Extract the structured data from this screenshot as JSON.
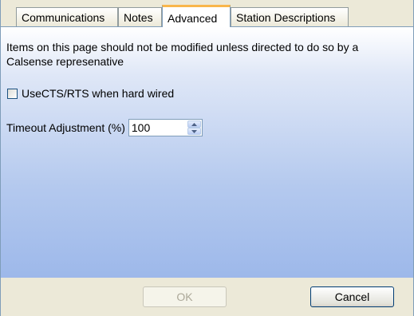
{
  "tabs": [
    {
      "label": "Communications",
      "active": false
    },
    {
      "label": "Notes",
      "active": false
    },
    {
      "label": "Advanced",
      "active": true
    },
    {
      "label": "Station Descriptions",
      "active": false
    }
  ],
  "advanced": {
    "description": "Items on this page should not be modified unless directed to do so by a Calsense represenative",
    "use_cts_rts": {
      "label": "UseCTS/RTS when hard wired",
      "checked": false
    },
    "timeout_adjustment": {
      "label": "Timeout Adjustment (%)",
      "value": "100"
    }
  },
  "buttons": {
    "ok": "OK",
    "ok_enabled": false,
    "cancel": "Cancel"
  },
  "colors": {
    "active_tab_accent": "#f9b64b",
    "page_gradient_bottom": "#9db8ea",
    "dialog_face": "#ece9d8"
  },
  "icons": {
    "spin_up": "triangle-up-icon",
    "spin_down": "triangle-down-icon"
  }
}
